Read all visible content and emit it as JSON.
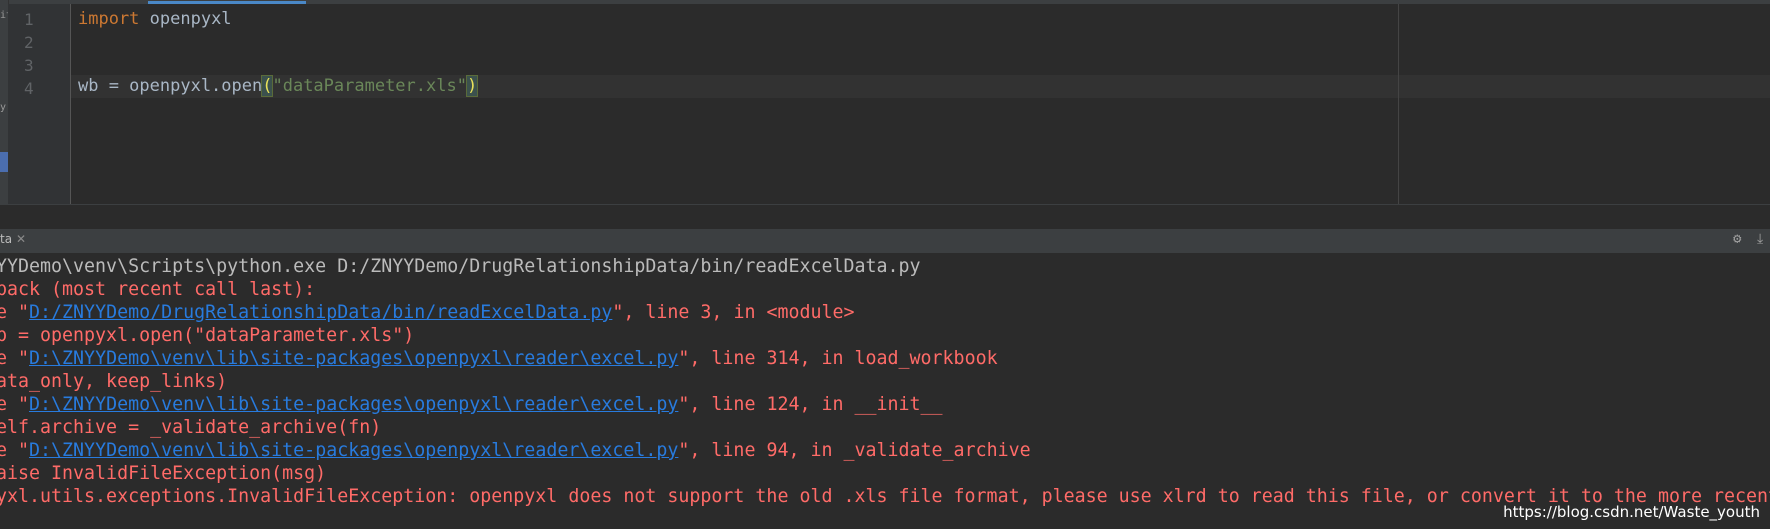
{
  "left_strip": {
    "tab_fragment_1": "ito",
    "tab_fragment_2": "y"
  },
  "editor": {
    "line_numbers": [
      "1",
      "2",
      "3",
      "4"
    ],
    "line1": {
      "keyword": "import",
      "rest": " openpyxl"
    },
    "line4": {
      "prefix": "wb = openpyxl.open",
      "open_paren": "(",
      "string": "\"dataParameter.xls\"",
      "close_paren": ")"
    }
  },
  "run_panel": {
    "tab_label": "ta",
    "close": "✕",
    "settings_icon": "gear-icon",
    "download_icon": "download-icon"
  },
  "console": {
    "cmd": "YYDemo\\venv\\Scripts\\python.exe D:/ZNYYDemo/DrugRelationshipData/bin/readExcelData.py",
    "traceback": "back (most recent call last):",
    "f1_pre": "e \"",
    "f1_link": "D:/ZNYYDemo/DrugRelationshipData/bin/readExcelData.py",
    "f1_post": "\", line 3, in <module>",
    "code1": "b = openpyxl.open(\"dataParameter.xls\")",
    "f2_pre": "e \"",
    "f2_link": "D:\\ZNYYDemo\\venv\\lib\\site-packages\\openpyxl\\reader\\excel.py",
    "f2_post": "\", line 314, in load_workbook",
    "code2": "ata_only, keep_links)",
    "f3_pre": "e \"",
    "f3_link": "D:\\ZNYYDemo\\venv\\lib\\site-packages\\openpyxl\\reader\\excel.py",
    "f3_post": "\", line 124, in __init__",
    "code3": "elf.archive = _validate_archive(fn)",
    "f4_pre": "e \"",
    "f4_link": "D:\\ZNYYDemo\\venv\\lib\\site-packages\\openpyxl\\reader\\excel.py",
    "f4_post": "\", line 94, in _validate_archive",
    "code4": "aise InvalidFileException(msg)",
    "error": "yxl.utils.exceptions.InvalidFileException: openpyxl does not support the old .xls file format, please use xlrd to read this file, or convert it to the more recent"
  },
  "watermark": "https://blog.csdn.net/Waste_youth",
  "colors": {
    "keyword": "#cc7832",
    "string": "#6a8759",
    "error": "#ff6b68",
    "link": "#287bde",
    "bg": "#2b2b2b"
  }
}
